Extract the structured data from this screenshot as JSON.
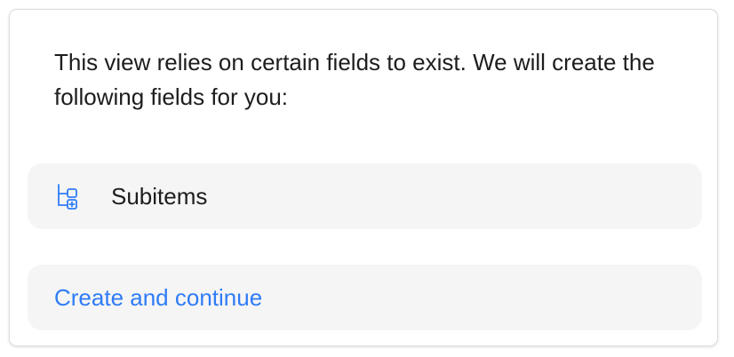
{
  "dialog": {
    "message": "This view relies on certain fields to exist. We will create the following fields for you:",
    "fields": [
      {
        "label": "Subitems",
        "icon": "subitems-icon"
      }
    ],
    "action_label": "Create and continue"
  },
  "colors": {
    "text": "#1d1d1f",
    "accent": "#2f7cf6",
    "row_background": "#f5f5f5",
    "card_border": "#dcdcdc"
  }
}
